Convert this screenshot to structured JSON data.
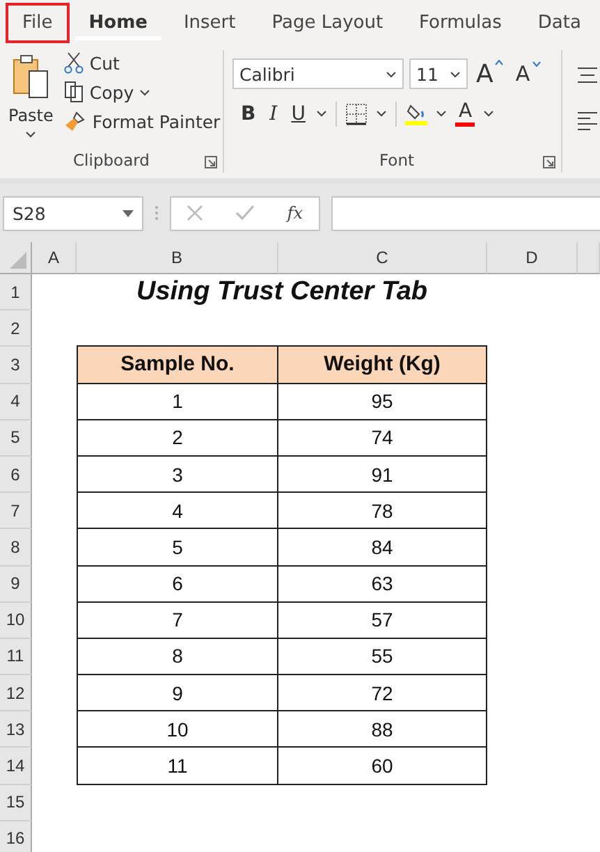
{
  "tabs": [
    {
      "label": "File",
      "selected": false,
      "outlined": true
    },
    {
      "label": "Home",
      "selected": true,
      "outlined": false
    },
    {
      "label": "Insert",
      "selected": false,
      "outlined": false
    },
    {
      "label": "Page Layout",
      "selected": false,
      "outlined": false
    },
    {
      "label": "Formulas",
      "selected": false,
      "outlined": false
    },
    {
      "label": "Data",
      "selected": false,
      "outlined": false
    }
  ],
  "clipboard": {
    "paste": "Paste",
    "cut": "Cut",
    "copy": "Copy",
    "format_painter": "Format Painter",
    "group": "Clipboard"
  },
  "font": {
    "font_name": "Calibri",
    "font_size": "11",
    "grow": "A",
    "shrink": "A",
    "bold": "B",
    "italic": "I",
    "underline": "U",
    "font_color": "A",
    "group": "Font"
  },
  "formula_bar": {
    "name_box": "S28",
    "fx": "fx"
  },
  "columns": [
    "A",
    "B",
    "C",
    "D"
  ],
  "sheet_rows": [
    {
      "number": "1",
      "kind": "title",
      "text": "Using Trust Center Tab"
    },
    {
      "number": "2",
      "kind": "blank"
    },
    {
      "number": "3",
      "kind": "header",
      "cells": [
        "Sample No.",
        "Weight (Kg)"
      ]
    },
    {
      "number": "4",
      "kind": "data",
      "cells": [
        "1",
        "95"
      ]
    },
    {
      "number": "5",
      "kind": "data",
      "cells": [
        "2",
        "74"
      ]
    },
    {
      "number": "6",
      "kind": "data",
      "cells": [
        "3",
        "91"
      ]
    },
    {
      "number": "7",
      "kind": "data",
      "cells": [
        "4",
        "78"
      ]
    },
    {
      "number": "8",
      "kind": "data",
      "cells": [
        "5",
        "84"
      ]
    },
    {
      "number": "9",
      "kind": "data",
      "cells": [
        "6",
        "63"
      ]
    },
    {
      "number": "10",
      "kind": "data",
      "cells": [
        "7",
        "57"
      ]
    },
    {
      "number": "11",
      "kind": "data",
      "cells": [
        "8",
        "55"
      ]
    },
    {
      "number": "12",
      "kind": "data",
      "cells": [
        "9",
        "72"
      ]
    },
    {
      "number": "13",
      "kind": "data",
      "cells": [
        "10",
        "88"
      ]
    },
    {
      "number": "14",
      "kind": "data",
      "cells": [
        "11",
        "60"
      ]
    },
    {
      "number": "15",
      "kind": "blank"
    },
    {
      "number": "16",
      "kind": "blank"
    }
  ]
}
